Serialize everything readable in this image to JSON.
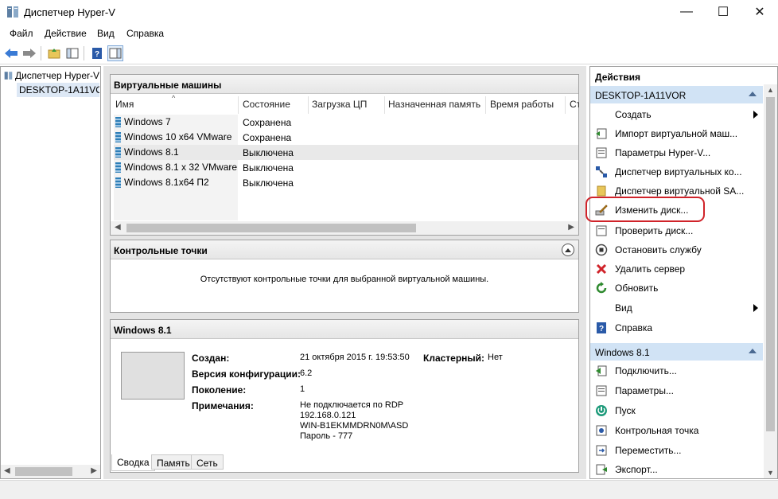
{
  "window": {
    "title": "Диспетчер Hyper-V",
    "min": "—",
    "max": "☐",
    "close": "✕"
  },
  "menu": [
    "Файл",
    "Действие",
    "Вид",
    "Справка"
  ],
  "tree": {
    "root": "Диспетчер Hyper-V",
    "host": "DESKTOP-1A11VOR"
  },
  "vms": {
    "title": "Виртуальные машины",
    "columns": [
      "Имя",
      "Состояние",
      "Загрузка ЦП",
      "Назначенная память",
      "Время работы",
      "Ст"
    ],
    "rows": [
      {
        "name": "Windows 7",
        "state": "Сохранена"
      },
      {
        "name": "Windows 10 x64 VMware",
        "state": "Сохранена"
      },
      {
        "name": "Windows 8.1",
        "state": "Выключена"
      },
      {
        "name": "Windows 8.1 x 32 VMware",
        "state": "Выключена"
      },
      {
        "name": "Windows 8.1x64 П2",
        "state": "Выключена"
      }
    ]
  },
  "checkpoints": {
    "title": "Контрольные точки",
    "empty": "Отсутствуют контрольные точки для выбранной виртуальной машины."
  },
  "details": {
    "title": "Windows 8.1",
    "created_label": "Создан:",
    "created": "21 октября 2015 г. 19:53:50",
    "clustered_label": "Кластерный:",
    "clustered": "Нет",
    "config_label": "Версия конфигурации:",
    "config": "6.2",
    "gen_label": "Поколение:",
    "gen": "1",
    "notes_label": "Примечания:",
    "notes": [
      "Не подключается по RDP",
      "192.168.0.121",
      "WIN-B1EKMMDRN0M\\ASD",
      "Пароль - 777"
    ],
    "tabs": [
      "Сводка",
      "Память",
      "Сеть"
    ]
  },
  "actions": {
    "title": "Действия",
    "host_group": "DESKTOP-1A11VOR",
    "host_items": [
      {
        "label": "Создать",
        "icon": "none",
        "submenu": true
      },
      {
        "label": "Импорт виртуальной маш...",
        "icon": "import-icon"
      },
      {
        "label": "Параметры Hyper-V...",
        "icon": "settings-icon"
      },
      {
        "label": "Диспетчер виртуальных ко...",
        "icon": "switch-manager-icon"
      },
      {
        "label": "Диспетчер виртуальной SA...",
        "icon": "san-manager-icon"
      },
      {
        "label": "Изменить диск...",
        "icon": "edit-disk-icon"
      },
      {
        "label": "Проверить диск...",
        "icon": "inspect-disk-icon"
      },
      {
        "label": "Остановить службу",
        "icon": "stop-service-icon"
      },
      {
        "label": "Удалить сервер",
        "icon": "remove-server-icon"
      },
      {
        "label": "Обновить",
        "icon": "refresh-icon"
      },
      {
        "label": "Вид",
        "icon": "none",
        "submenu": true
      },
      {
        "label": "Справка",
        "icon": "help-icon"
      }
    ],
    "vm_group": "Windows 8.1",
    "vm_items": [
      {
        "label": "Подключить...",
        "icon": "connect-icon"
      },
      {
        "label": "Параметры...",
        "icon": "vm-settings-icon"
      },
      {
        "label": "Пуск",
        "icon": "start-icon"
      },
      {
        "label": "Контрольная точка",
        "icon": "checkpoint-icon"
      },
      {
        "label": "Переместить...",
        "icon": "move-icon"
      },
      {
        "label": "Экспорт...",
        "icon": "export-icon"
      }
    ]
  },
  "colors": {
    "highlight_ring": "#d0232a",
    "group_bg": "#d1e3f5",
    "selection": "#dde8f5"
  }
}
